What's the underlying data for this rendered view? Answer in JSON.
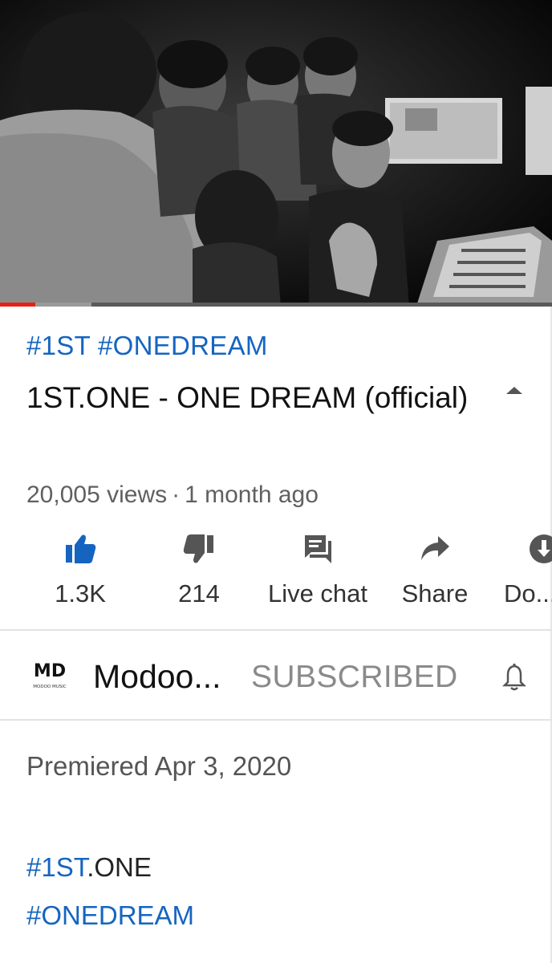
{
  "video": {
    "progress_played": 0.064,
    "progress_buffered": 0.165,
    "thumbnail_desc_icon": "video-frame"
  },
  "info": {
    "hashtags": "#1ST #ONEDREAM",
    "title": "1ST.ONE - ONE DREAM (official)",
    "views": "20,005 views",
    "separator": "·",
    "age": "1 month ago"
  },
  "actions": [
    {
      "name": "like",
      "icon": "thumbs-up-icon",
      "label": "1.3K",
      "active": true
    },
    {
      "name": "dislike",
      "icon": "thumbs-down-icon",
      "label": "214"
    },
    {
      "name": "live-chat",
      "icon": "chat-icon",
      "label": "Live chat"
    },
    {
      "name": "share",
      "icon": "share-icon",
      "label": "Share"
    },
    {
      "name": "download",
      "icon": "download-icon",
      "label": "Do..."
    }
  ],
  "channel": {
    "avatar_text": "MD",
    "avatar_subtext": "MODOO MUSIC",
    "name": "Modoo...",
    "subscribe_label": "SUBSCRIBED"
  },
  "description": {
    "premiered": "Premiered Apr 3, 2020",
    "tag1_link": "#1ST",
    "tag1_rest": ".ONE",
    "tag2": "#ONEDREAM"
  },
  "colors": {
    "link_blue": "#1565c0",
    "like_blue": "#1565c0",
    "progress_red": "#e62117",
    "muted_text": "#606060"
  }
}
